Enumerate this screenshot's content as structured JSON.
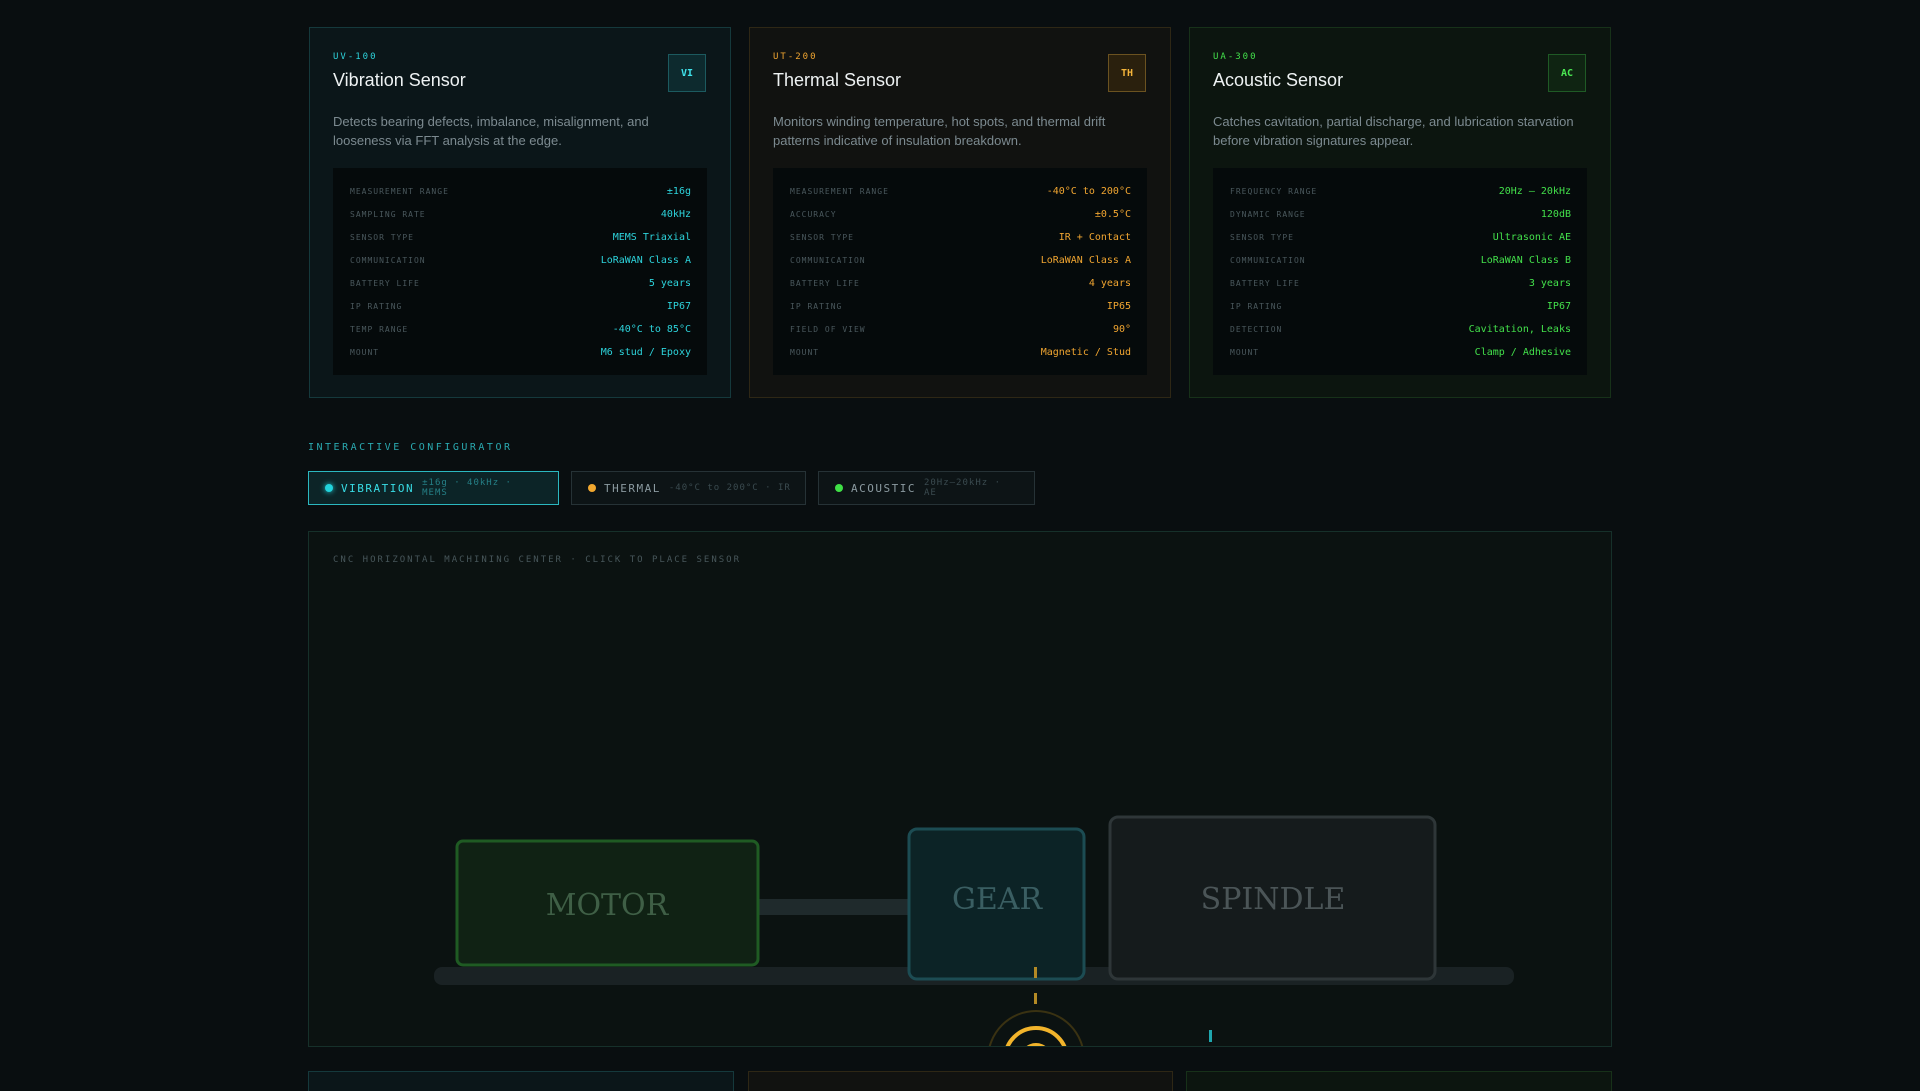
{
  "sensors": [
    {
      "key": "vib",
      "model": "UV-100",
      "title": "Vibration Sensor",
      "badge": "VI",
      "description": "Detects bearing defects, imbalance, misalignment, and looseness via FFT analysis at the edge.",
      "specs": [
        {
          "label": "MEASUREMENT RANGE",
          "value": "±16g"
        },
        {
          "label": "SAMPLING RATE",
          "value": "40kHz"
        },
        {
          "label": "SENSOR TYPE",
          "value": "MEMS Triaxial"
        },
        {
          "label": "COMMUNICATION",
          "value": "LoRaWAN Class A"
        },
        {
          "label": "BATTERY LIFE",
          "value": "5 years"
        },
        {
          "label": "IP RATING",
          "value": "IP67"
        },
        {
          "label": "TEMP RANGE",
          "value": "-40°C to 85°C"
        },
        {
          "label": "MOUNT",
          "value": "M6 stud / Epoxy"
        }
      ]
    },
    {
      "key": "thr",
      "model": "UT-200",
      "title": "Thermal Sensor",
      "badge": "TH",
      "description": "Monitors winding temperature, hot spots, and thermal drift patterns indicative of insulation breakdown.",
      "specs": [
        {
          "label": "MEASUREMENT RANGE",
          "value": "-40°C to 200°C"
        },
        {
          "label": "ACCURACY",
          "value": "±0.5°C"
        },
        {
          "label": "SENSOR TYPE",
          "value": "IR + Contact"
        },
        {
          "label": "COMMUNICATION",
          "value": "LoRaWAN Class A"
        },
        {
          "label": "BATTERY LIFE",
          "value": "4 years"
        },
        {
          "label": "IP RATING",
          "value": "IP65"
        },
        {
          "label": "FIELD OF VIEW",
          "value": "90°"
        },
        {
          "label": "MOUNT",
          "value": "Magnetic / Stud"
        }
      ]
    },
    {
      "key": "aco",
      "model": "UA-300",
      "title": "Acoustic Sensor",
      "badge": "AC",
      "description": "Catches cavitation, partial discharge, and lubrication starvation before vibration signatures appear.",
      "specs": [
        {
          "label": "FREQUENCY RANGE",
          "value": "20Hz – 20kHz"
        },
        {
          "label": "DYNAMIC RANGE",
          "value": "120dB"
        },
        {
          "label": "SENSOR TYPE",
          "value": "Ultrasonic AE"
        },
        {
          "label": "COMMUNICATION",
          "value": "LoRaWAN Class B"
        },
        {
          "label": "BATTERY LIFE",
          "value": "3 years"
        },
        {
          "label": "IP RATING",
          "value": "IP67"
        },
        {
          "label": "DETECTION",
          "value": "Cavitation, Leaks"
        },
        {
          "label": "MOUNT",
          "value": "Clamp / Adhesive"
        }
      ]
    }
  ],
  "configurator": {
    "section_label": "INTERACTIVE CONFIGURATOR",
    "chips": [
      {
        "label": "VIBRATION",
        "sub": "±16g · 40kHz · MEMS",
        "color": "#22d3dc",
        "active": true
      },
      {
        "label": "THERMAL",
        "sub": "-40°C to 200°C · IR",
        "color": "#f2a82f",
        "active": false
      },
      {
        "label": "ACOUSTIC",
        "sub": "20Hz–20kHz · AE",
        "color": "#3fe046",
        "active": false
      }
    ],
    "canvas_label": "CNC HORIZONTAL MACHINING CENTER · CLICK TO PLACE SENSOR",
    "machine": {
      "motor_label": "MOTOR",
      "gear_label": "GEAR",
      "spindle_label": "SPINDLE"
    }
  },
  "colors": {
    "vibration": "#2dd3db",
    "thermal": "#f0a531",
    "acoustic": "#43e04b",
    "background": "#090e10"
  }
}
